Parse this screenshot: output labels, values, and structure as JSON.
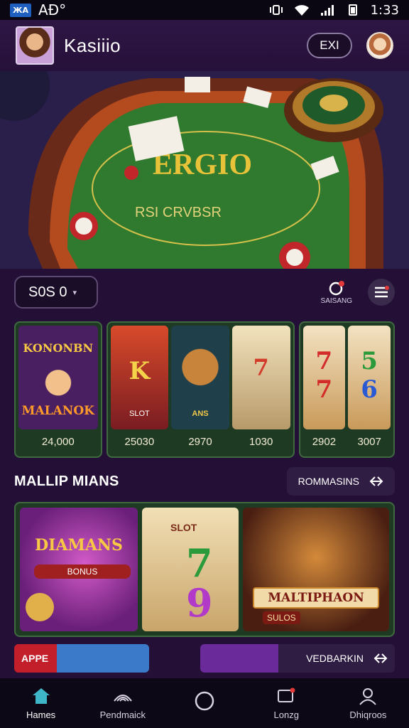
{
  "status_bar": {
    "badge": "ЖА",
    "left_text": "AÐ°",
    "time": "1:33"
  },
  "header": {
    "title": "Kasiiio",
    "exit_label": "EXI"
  },
  "hero": {
    "table_text": "ERGIO",
    "table_subtext": "RSI CRVBSR"
  },
  "toolbar": {
    "balance": "S0S 0",
    "saving_label": "SAISANG"
  },
  "games": [
    {
      "title": "KONONBN",
      "subtitle": "MALANOK",
      "value": "24,000",
      "theme": "#6d2c8a"
    },
    {
      "title": "",
      "subtitle": "SLOT",
      "value": "25030",
      "theme": "#b23a2e"
    },
    {
      "title": "",
      "subtitle": "ANS",
      "value": "2970",
      "theme": "#2a5b6d"
    },
    {
      "title": "",
      "subtitle": "",
      "value": "1030",
      "theme": "#d9c59a"
    },
    {
      "title": "",
      "subtitle": "",
      "value": "2902",
      "theme": "#c98b4d"
    },
    {
      "title": "",
      "subtitle": "",
      "value": "3007",
      "theme": "#d9c59a"
    }
  ],
  "section": {
    "title": "MALLIP MIANS",
    "action_label": "ROMMASINS"
  },
  "featured": [
    {
      "title": "DIAMANS",
      "subtitle": "BONUS",
      "theme": "#7a2f8f"
    },
    {
      "title": "SLOT",
      "subtitle": "",
      "theme": "#e8d4a4"
    },
    {
      "title": "MALTIPHAON",
      "subtitle": "SULOS",
      "theme": "#7a2a1c"
    }
  ],
  "promos": {
    "left_label": "APPE",
    "right_label": "VEDBARKIN"
  },
  "bottom_nav": [
    {
      "label": "Hames",
      "icon": "home-icon"
    },
    {
      "label": "Pendmaick",
      "icon": "wave-icon"
    },
    {
      "label": "",
      "icon": "circle-icon"
    },
    {
      "label": "Lonzg",
      "icon": "message-icon"
    },
    {
      "label": "Dhiqroos",
      "icon": "user-icon"
    }
  ]
}
